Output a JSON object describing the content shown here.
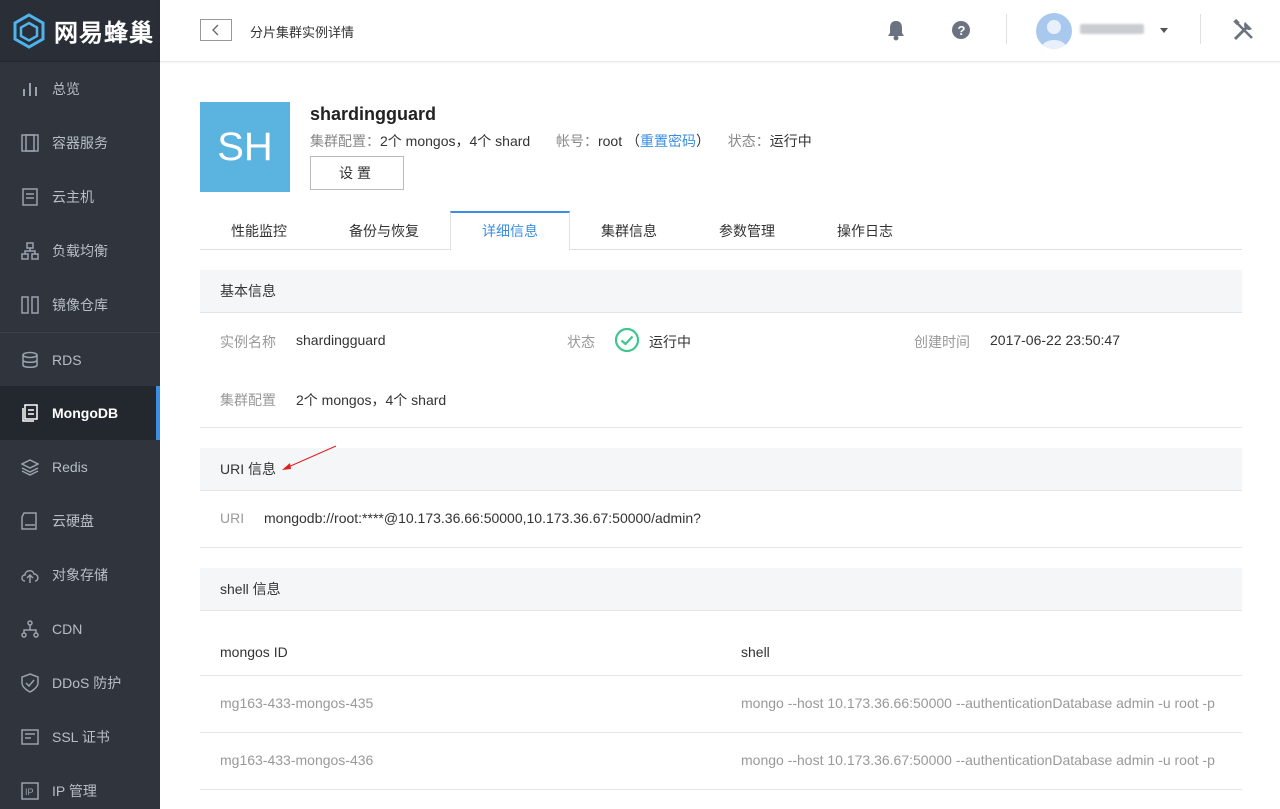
{
  "brand": {
    "name": "网易蜂巢"
  },
  "sidebar": {
    "items": [
      {
        "label": "总览",
        "icon": "bar-chart-icon"
      },
      {
        "label": "容器服务",
        "icon": "container-icon"
      },
      {
        "label": "云主机",
        "icon": "server-icon"
      },
      {
        "label": "负载均衡",
        "icon": "network-icon"
      },
      {
        "label": "镜像仓库",
        "icon": "repository-icon"
      },
      {
        "label": "RDS",
        "icon": "database-icon"
      },
      {
        "label": "MongoDB",
        "icon": "document-icon"
      },
      {
        "label": "Redis",
        "icon": "layers-icon"
      },
      {
        "label": "云硬盘",
        "icon": "disk-icon"
      },
      {
        "label": "对象存储",
        "icon": "cloud-upload-icon"
      },
      {
        "label": "CDN",
        "icon": "cdn-icon"
      },
      {
        "label": "DDoS 防护",
        "icon": "shield-icon"
      },
      {
        "label": "SSL 证书",
        "icon": "certificate-icon"
      },
      {
        "label": "IP 管理",
        "icon": "ip-icon"
      }
    ],
    "active": "MongoDB"
  },
  "header": {
    "title": "分片集群实例详情"
  },
  "instance": {
    "avatar_text": "SH",
    "name": "shardingguard",
    "cluster_label": "集群配置：",
    "cluster_value": "2个 mongos，4个 shard",
    "account_label": "帐号：",
    "account_value": "root",
    "paren_open": "（",
    "reset_password": "重置密码",
    "paren_close": "）",
    "status_label": "状态：",
    "status_value": "运行中",
    "settings_button": "设置"
  },
  "tabs": [
    {
      "label": "性能监控"
    },
    {
      "label": "备份与恢复"
    },
    {
      "label": "详细信息"
    },
    {
      "label": "集群信息"
    },
    {
      "label": "参数管理"
    },
    {
      "label": "操作日志"
    }
  ],
  "basic_info": {
    "title": "基本信息",
    "name_label": "实例名称",
    "name_value": "shardingguard",
    "status_label": "状态",
    "status_value": "运行中",
    "created_label": "创建时间",
    "created_value": "2017-06-22 23:50:47",
    "cluster_label": "集群配置",
    "cluster_value": "2个 mongos，4个 shard"
  },
  "uri_info": {
    "title": "URI 信息",
    "label": "URI",
    "value": "mongodb://root:****@10.173.36.66:50000,10.173.36.67:50000/admin?"
  },
  "shell_info": {
    "title": "shell 信息",
    "columns": [
      "mongos ID",
      "shell"
    ],
    "rows": [
      {
        "id": "mg163-433-mongos-435",
        "shell": "mongo --host 10.173.36.66:50000 --authenticationDatabase admin -u root -p"
      },
      {
        "id": "mg163-433-mongos-436",
        "shell": "mongo --host 10.173.36.67:50000 --authenticationDatabase admin -u root -p"
      }
    ]
  },
  "colors": {
    "accent": "#3a8ee6",
    "sidebar_bg": "#2f343d",
    "success": "#3cc78f",
    "avatar_bg": "#5bb3e0",
    "annotation": "#e02020"
  }
}
